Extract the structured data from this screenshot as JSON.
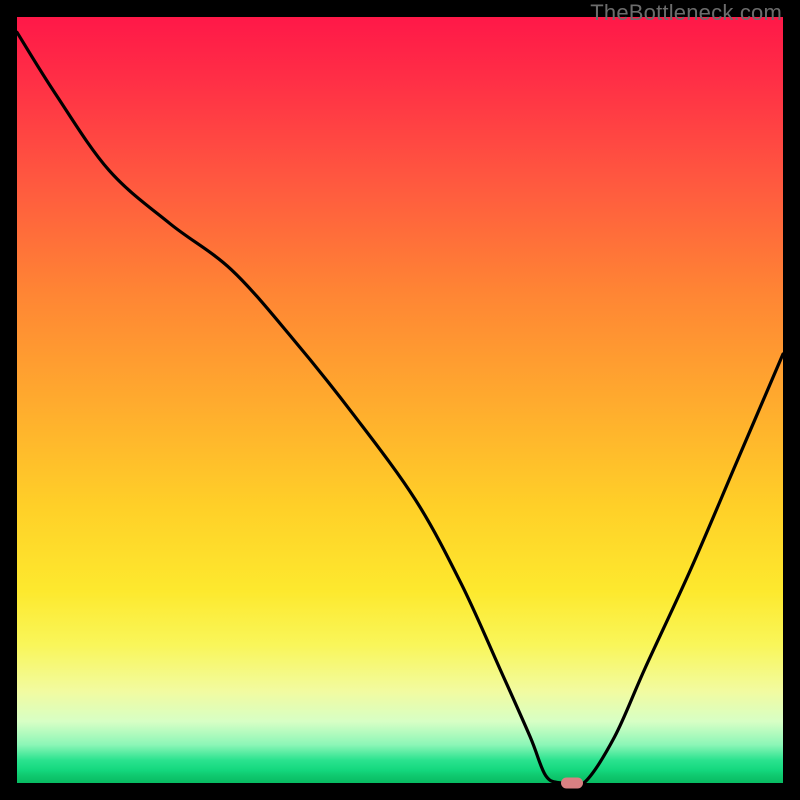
{
  "watermark": "TheBottleneck.com",
  "colors": {
    "background": "#000000",
    "curve": "#000000",
    "marker": "#d98082"
  },
  "chart_data": {
    "type": "line",
    "title": "",
    "xlabel": "",
    "ylabel": "",
    "xlim": [
      0,
      100
    ],
    "ylim": [
      0,
      100
    ],
    "grid": false,
    "series": [
      {
        "name": "bottleneck-curve",
        "x": [
          0,
          5,
          12,
          20,
          28,
          36,
          44,
          52,
          58,
          63,
          67,
          69,
          71,
          74,
          78,
          82,
          88,
          94,
          100
        ],
        "y": [
          98,
          90,
          80,
          73,
          67,
          58,
          48,
          37,
          26,
          15,
          6,
          1,
          0,
          0,
          6,
          15,
          28,
          42,
          56
        ]
      }
    ],
    "marker": {
      "x": 72.5,
      "y": 0
    },
    "gradient_stops": [
      {
        "pos": 0.0,
        "color": "#ff1848"
      },
      {
        "pos": 0.5,
        "color": "#ffaa2e"
      },
      {
        "pos": 0.82,
        "color": "#f9f65a"
      },
      {
        "pos": 1.0,
        "color": "#08bb62"
      }
    ]
  }
}
